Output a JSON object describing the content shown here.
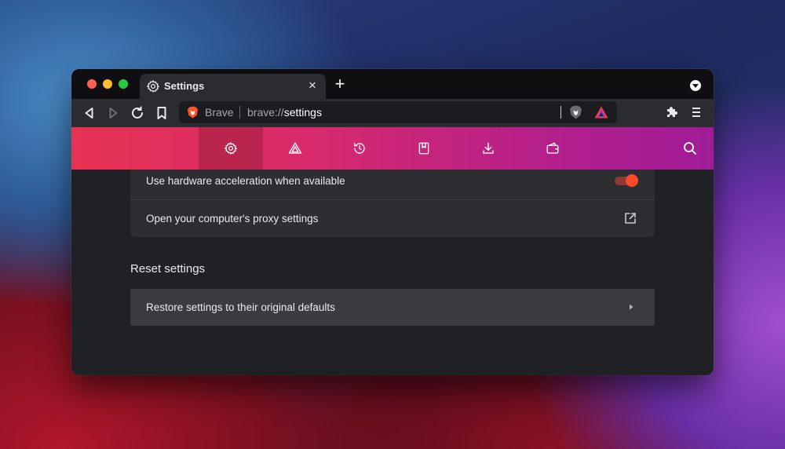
{
  "tabbar": {
    "tab": {
      "title": "Settings",
      "icon": "gear-icon",
      "close_label": "×"
    },
    "new_tab_label": "+"
  },
  "toolbar": {
    "omnibox": {
      "site_name": "Brave",
      "url_scheme": "brave://",
      "url_path": "settings"
    }
  },
  "settings_nav": {
    "items": [
      {
        "id": "get-started",
        "icon": "gear-icon",
        "active": true
      },
      {
        "id": "rewards",
        "icon": "rewards-triangle-icon",
        "active": false
      },
      {
        "id": "history",
        "icon": "history-icon",
        "active": false
      },
      {
        "id": "bookmarks",
        "icon": "bookmark-book-icon",
        "active": false
      },
      {
        "id": "downloads",
        "icon": "download-icon",
        "active": false
      },
      {
        "id": "wallet",
        "icon": "wallet-icon",
        "active": false
      }
    ]
  },
  "system": {
    "hardware_acceleration_label": "Use hardware acceleration when available",
    "hardware_acceleration_enabled": true,
    "proxy_label": "Open your computer's proxy settings"
  },
  "reset": {
    "section_title": "Reset settings",
    "restore_label": "Restore settings to their original defaults"
  },
  "colors": {
    "accent_toggle": "#ff4a2a",
    "nav_gradient_start": "#e63352",
    "nav_gradient_end": "#9f1c98",
    "window_bg": "#202124",
    "card_bg": "#2d2e31"
  }
}
